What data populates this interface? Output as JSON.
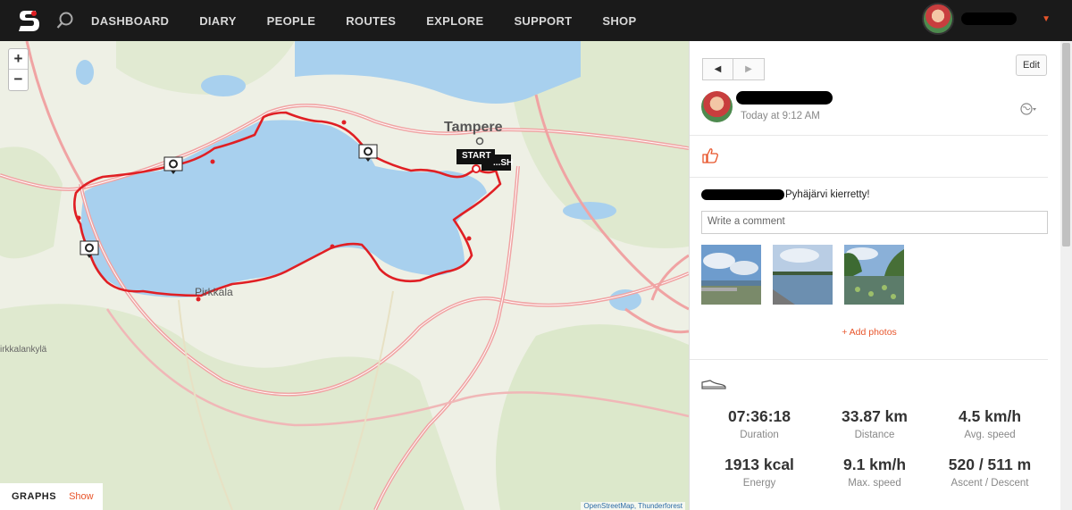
{
  "nav": {
    "items": [
      "DASHBOARD",
      "DIARY",
      "PEOPLE",
      "ROUTES",
      "EXPLORE",
      "SUPPORT",
      "SHOP"
    ]
  },
  "map": {
    "zoom_in": "+",
    "zoom_out": "−",
    "labels": {
      "city": "Tampere",
      "start": "START",
      "finish": "...SH",
      "town": "Pirkkala",
      "village": "irkkalankylä"
    },
    "graphs_label": "GRAPHS",
    "graphs_show": "Show",
    "attribution": "OpenStreetMap, Thunderforest"
  },
  "post": {
    "time": "Today at 9:12 AM",
    "edit_label": "Edit",
    "prev_icon": "◀",
    "next_icon": "▶",
    "caption": "Pyhäjärvi kierretty!",
    "comment_placeholder": "Write a comment",
    "add_photos": "+ Add photos"
  },
  "stats": [
    {
      "value": "07:36:18",
      "label": "Duration"
    },
    {
      "value": "33.87 km",
      "label": "Distance"
    },
    {
      "value": "4.5 km/h",
      "label": "Avg. speed"
    },
    {
      "value": "1913 kcal",
      "label": "Energy"
    },
    {
      "value": "9.1 km/h",
      "label": "Max. speed"
    },
    {
      "value": "520 / 511 m",
      "label": "Ascent / Descent"
    }
  ],
  "colors": {
    "accent": "#e8552b",
    "route": "#e01f24",
    "lake": "#a8d0ee",
    "topbar": "#1a1a1a"
  }
}
